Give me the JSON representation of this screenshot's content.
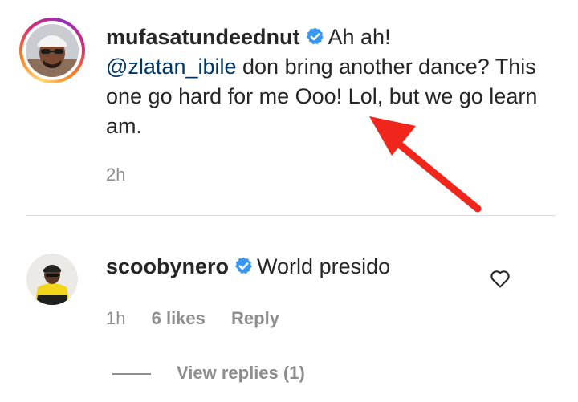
{
  "main_comment": {
    "username": "mufasatundeednut",
    "text_before_mention": "Ah ah!",
    "mention": "@zlatan_ibile",
    "text_after_mention": " don bring another dance? This one go hard for me Ooo! Lol, but we go learn am.",
    "time": "2h",
    "verified_icon": "verified-badge-icon"
  },
  "reply_comment": {
    "username": "scoobynero",
    "text": "World presido",
    "time": "1h",
    "likes": "6 likes",
    "reply_label": "Reply",
    "verified_icon": "verified-badge-icon",
    "like_icon": "heart-outline-icon"
  },
  "view_replies_label": "View replies (1)",
  "colors": {
    "verified_blue": "#3897f0",
    "mention_blue": "#00376b",
    "muted_gray": "#8e8e8e",
    "annotation_arrow_red": "#f0261d"
  }
}
